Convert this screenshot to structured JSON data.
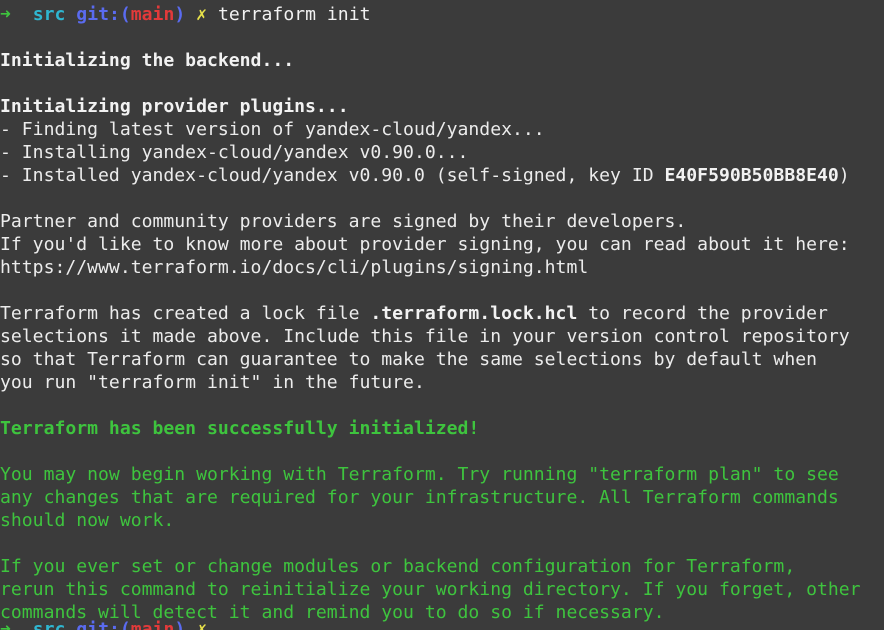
{
  "prompt": {
    "arrow": "➜",
    "dir": "src",
    "git_prefix": "git:(",
    "branch": "main",
    "git_suffix": ")",
    "dirty": "✗",
    "command": "terraform init"
  },
  "backend_heading": "Initializing the backend...",
  "plugins_heading": "Initializing provider plugins...",
  "plugin_lines": [
    "- Finding latest version of yandex-cloud/yandex...",
    "- Installing yandex-cloud/yandex v0.90.0..."
  ],
  "installed_line": {
    "prefix": "- Installed yandex-cloud/yandex v0.90.0 (self-signed, key ID ",
    "key_id": "E40F590B50BB8E40",
    "suffix": ")"
  },
  "signing_lines": [
    "Partner and community providers are signed by their developers.",
    "If you'd like to know more about provider signing, you can read about it here:",
    "https://www.terraform.io/docs/cli/plugins/signing.html"
  ],
  "lock_paragraph": {
    "line1_prefix": "Terraform has created a lock file ",
    "lock_file": ".terraform.lock.hcl",
    "line1_suffix": " to record the provider",
    "line2": "selections it made above. Include this file in your version control repository",
    "line3": "so that Terraform can guarantee to make the same selections by default when",
    "line4": "you run \"terraform init\" in the future."
  },
  "success_heading": "Terraform has been successfully initialized!",
  "next_steps": [
    "You may now begin working with Terraform. Try running \"terraform plan\" to see",
    "any changes that are required for your infrastructure. All Terraform commands",
    "should now work."
  ],
  "reinit_lines": [
    "If you ever set or change modules or backend configuration for Terraform,",
    "rerun this command to reinitialize your working directory. If you forget, other",
    "commands will detect it and remind you to do so if necessary."
  ],
  "colors": {
    "background": "#3b3b3b",
    "text": "#ececec",
    "green": "#3ec43e",
    "cyan": "#2fb6d0",
    "blue": "#5a6bf0",
    "red": "#e23a3a",
    "yellow": "#e8e24a"
  }
}
